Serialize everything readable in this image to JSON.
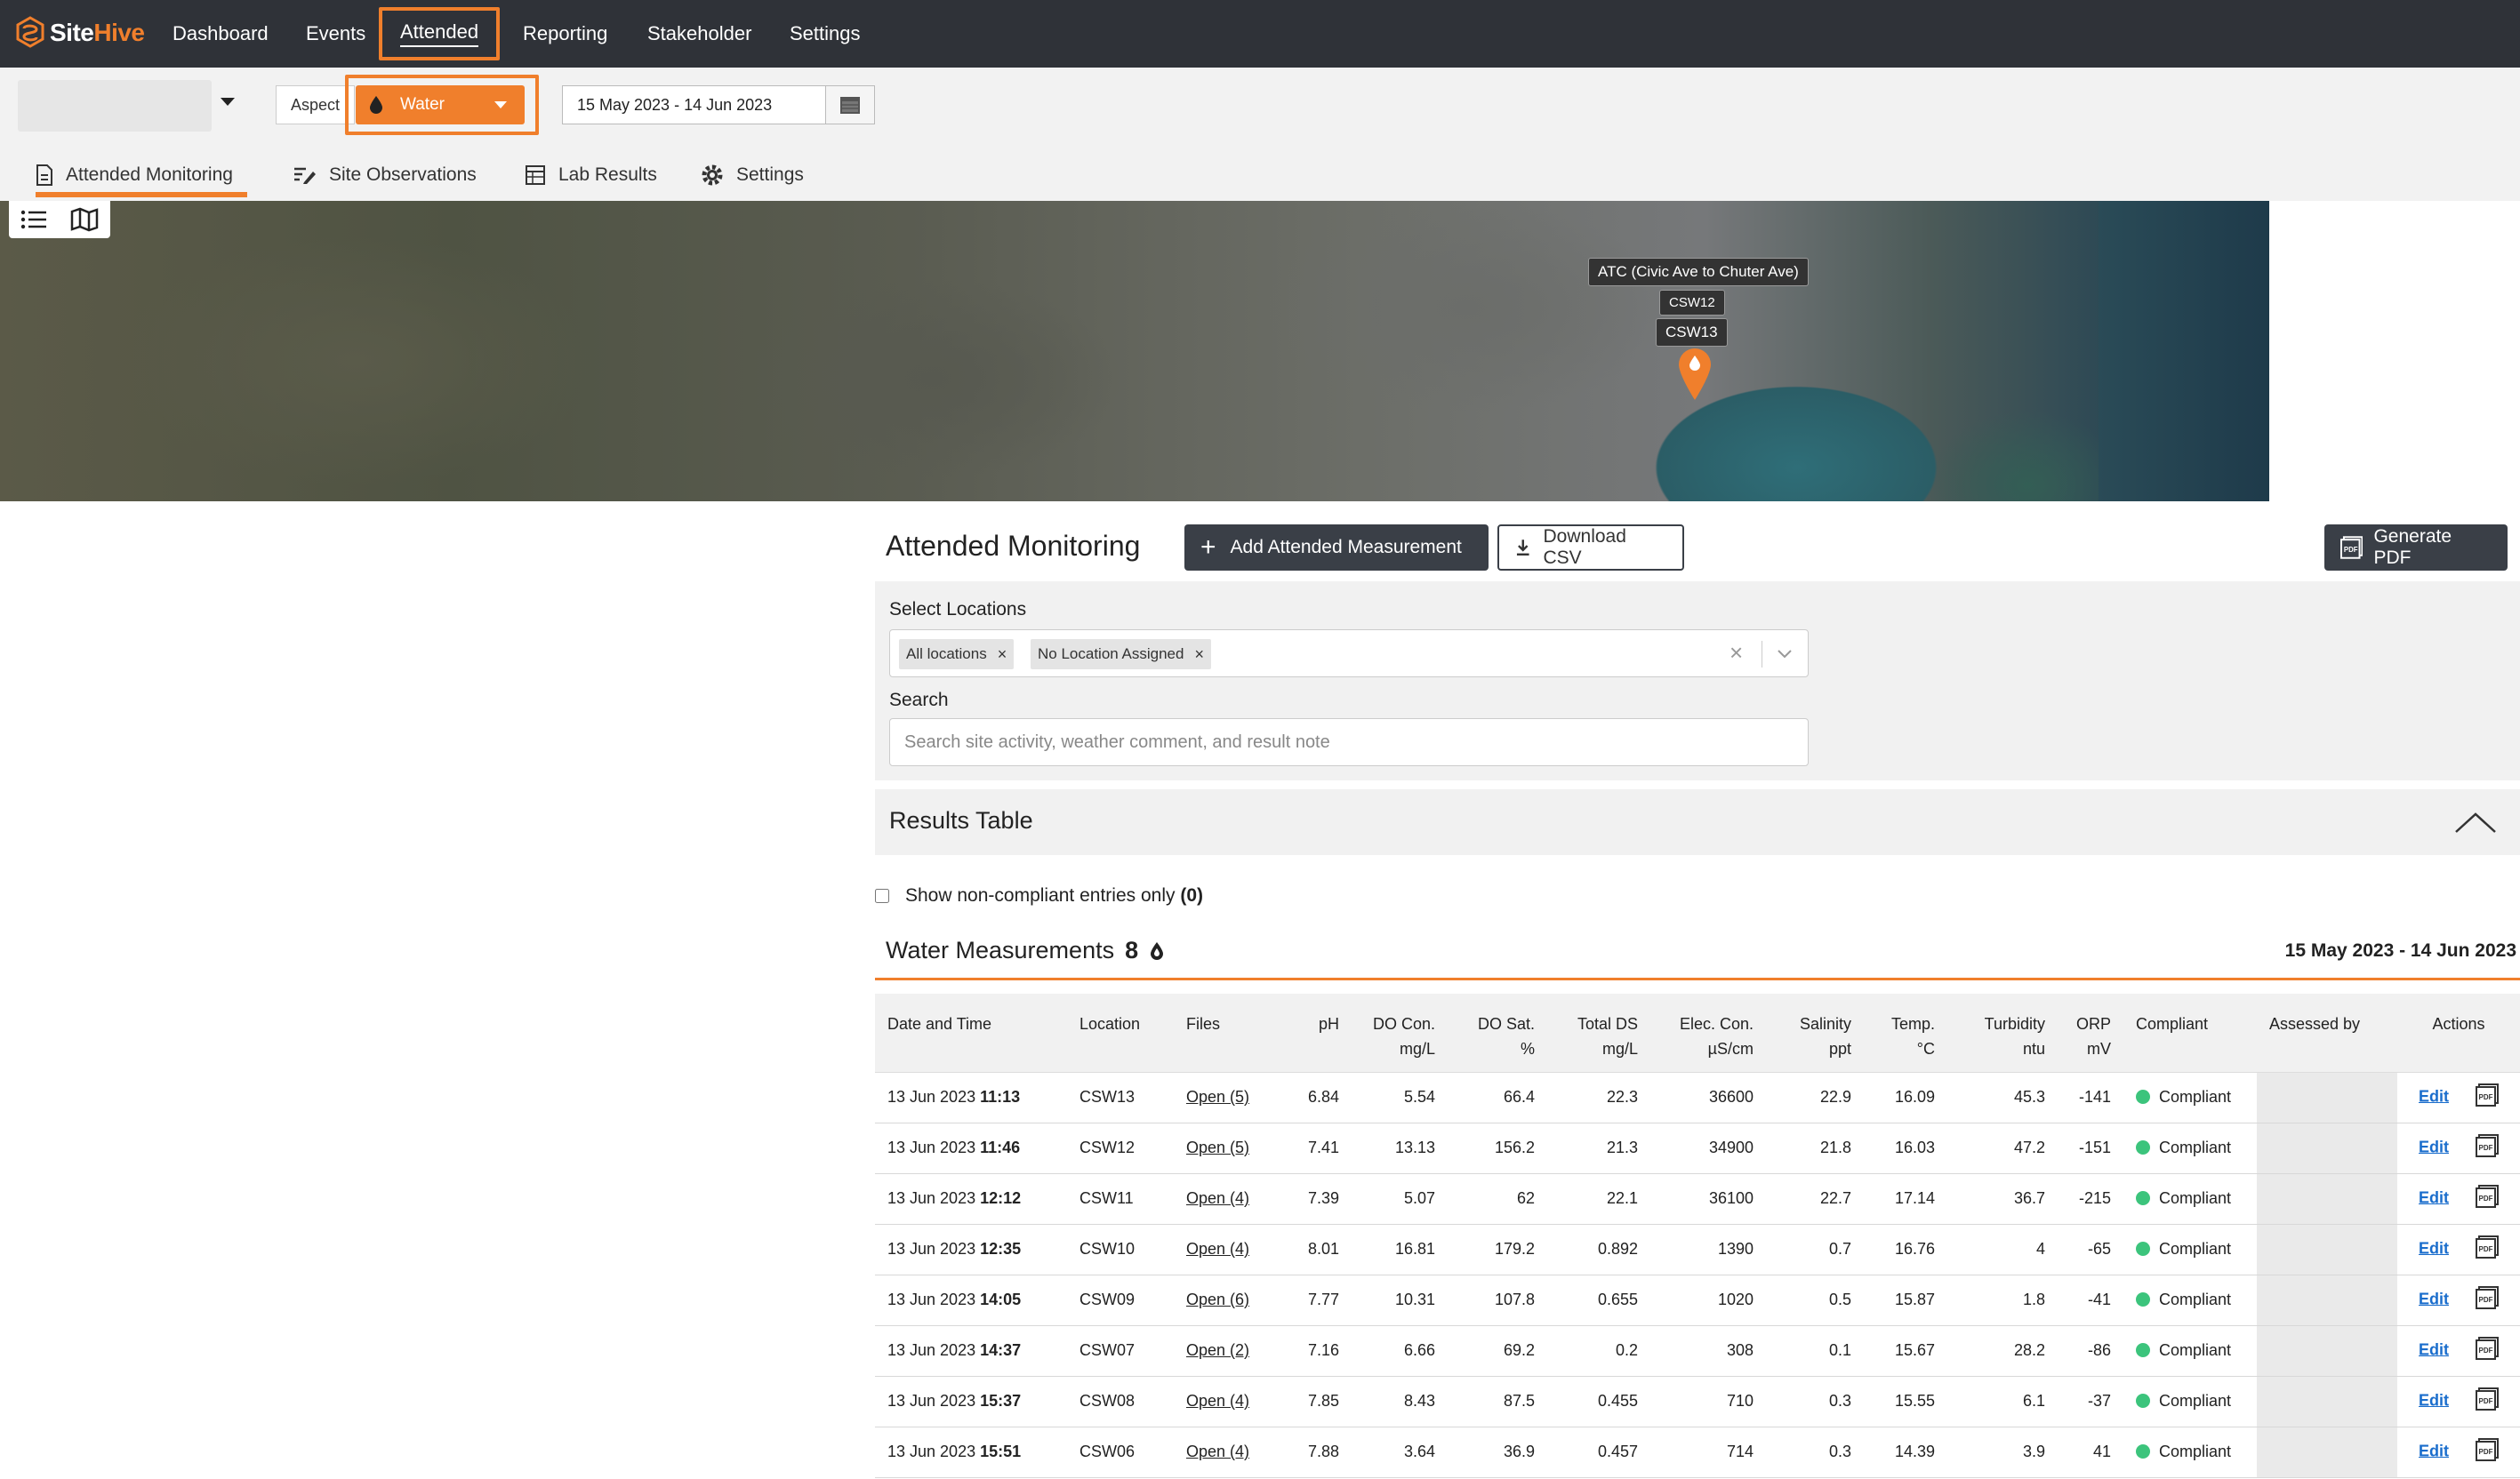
{
  "brand": {
    "name_part1": "Site",
    "name_part2": "Hive",
    "accent": "#f07f2c",
    "nav_bg": "#2f3238"
  },
  "nav": {
    "items": [
      "Dashboard",
      "Events",
      "Attended",
      "Reporting",
      "Stakeholder",
      "Settings"
    ],
    "active": "Attended"
  },
  "toolbar": {
    "aspect_label": "Aspect",
    "aspect_value": "Water",
    "date_range": "15 May 2023 - 14 Jun 2023"
  },
  "subtabs": [
    "Attended Monitoring",
    "Site Observations",
    "Lab Results",
    "Settings"
  ],
  "map": {
    "labels": [
      "ATC (Civic Ave to Chuter Ave)",
      "CSW12",
      "CSW13"
    ]
  },
  "main": {
    "title": "Attended Monitoring",
    "add_button": "Add Attended Measurement",
    "download_button": "Download CSV",
    "pdf_button": "Generate PDF"
  },
  "filters": {
    "locations_label": "Select Locations",
    "chips": [
      "All locations",
      "No Location Assigned"
    ],
    "search_label": "Search",
    "search_placeholder": "Search site activity, weather comment, and result note"
  },
  "results": {
    "title": "Results Table",
    "noncompliant_label": "Show non-compliant entries only",
    "noncompliant_count": "(0)"
  },
  "measurements": {
    "title": "Water Measurements",
    "count": "8",
    "date_range": "15 May 2023 - 14 Jun 2023",
    "headers": [
      {
        "top": "Date and Time",
        "unit": ""
      },
      {
        "top": "Location",
        "unit": ""
      },
      {
        "top": "Files",
        "unit": ""
      },
      {
        "top": "pH",
        "unit": ""
      },
      {
        "top": "DO Con.",
        "unit": "mg/L"
      },
      {
        "top": "DO Sat.",
        "unit": "%"
      },
      {
        "top": "Total DS",
        "unit": "mg/L"
      },
      {
        "top": "Elec. Con.",
        "unit": "µS/cm"
      },
      {
        "top": "Salinity",
        "unit": "ppt"
      },
      {
        "top": "Temp.",
        "unit": "°C"
      },
      {
        "top": "Turbidity",
        "unit": "ntu"
      },
      {
        "top": "ORP",
        "unit": "mV"
      },
      {
        "top": "Compliant",
        "unit": ""
      },
      {
        "top": "Assessed by",
        "unit": ""
      },
      {
        "top": "Actions",
        "unit": ""
      }
    ],
    "edit_label": "Edit",
    "rows": [
      {
        "date": "13 Jun 2023",
        "time": "11:13",
        "location": "CSW13",
        "files": "Open (5)",
        "ph": "6.84",
        "do_con": "5.54",
        "do_sat": "66.4",
        "tds": "22.3",
        "ec": "36600",
        "salinity": "22.9",
        "temp": "16.09",
        "turbidity": "45.3",
        "orp": "-141",
        "compliant": "Compliant"
      },
      {
        "date": "13 Jun 2023",
        "time": "11:46",
        "location": "CSW12",
        "files": "Open (5)",
        "ph": "7.41",
        "do_con": "13.13",
        "do_sat": "156.2",
        "tds": "21.3",
        "ec": "34900",
        "salinity": "21.8",
        "temp": "16.03",
        "turbidity": "47.2",
        "orp": "-151",
        "compliant": "Compliant"
      },
      {
        "date": "13 Jun 2023",
        "time": "12:12",
        "location": "CSW11",
        "files": "Open (4)",
        "ph": "7.39",
        "do_con": "5.07",
        "do_sat": "62",
        "tds": "22.1",
        "ec": "36100",
        "salinity": "22.7",
        "temp": "17.14",
        "turbidity": "36.7",
        "orp": "-215",
        "compliant": "Compliant"
      },
      {
        "date": "13 Jun 2023",
        "time": "12:35",
        "location": "CSW10",
        "files": "Open (4)",
        "ph": "8.01",
        "do_con": "16.81",
        "do_sat": "179.2",
        "tds": "0.892",
        "ec": "1390",
        "salinity": "0.7",
        "temp": "16.76",
        "turbidity": "4",
        "orp": "-65",
        "compliant": "Compliant"
      },
      {
        "date": "13 Jun 2023",
        "time": "14:05",
        "location": "CSW09",
        "files": "Open (6)",
        "ph": "7.77",
        "do_con": "10.31",
        "do_sat": "107.8",
        "tds": "0.655",
        "ec": "1020",
        "salinity": "0.5",
        "temp": "15.87",
        "turbidity": "1.8",
        "orp": "-41",
        "compliant": "Compliant"
      },
      {
        "date": "13 Jun 2023",
        "time": "14:37",
        "location": "CSW07",
        "files": "Open (2)",
        "ph": "7.16",
        "do_con": "6.66",
        "do_sat": "69.2",
        "tds": "0.2",
        "ec": "308",
        "salinity": "0.1",
        "temp": "15.67",
        "turbidity": "28.2",
        "orp": "-86",
        "compliant": "Compliant"
      },
      {
        "date": "13 Jun 2023",
        "time": "15:37",
        "location": "CSW08",
        "files": "Open (4)",
        "ph": "7.85",
        "do_con": "8.43",
        "do_sat": "87.5",
        "tds": "0.455",
        "ec": "710",
        "salinity": "0.3",
        "temp": "15.55",
        "turbidity": "6.1",
        "orp": "-37",
        "compliant": "Compliant"
      },
      {
        "date": "13 Jun 2023",
        "time": "15:51",
        "location": "CSW06",
        "files": "Open (4)",
        "ph": "7.88",
        "do_con": "3.64",
        "do_sat": "36.9",
        "tds": "0.457",
        "ec": "714",
        "salinity": "0.3",
        "temp": "14.39",
        "turbidity": "3.9",
        "orp": "41",
        "compliant": "Compliant"
      }
    ]
  }
}
